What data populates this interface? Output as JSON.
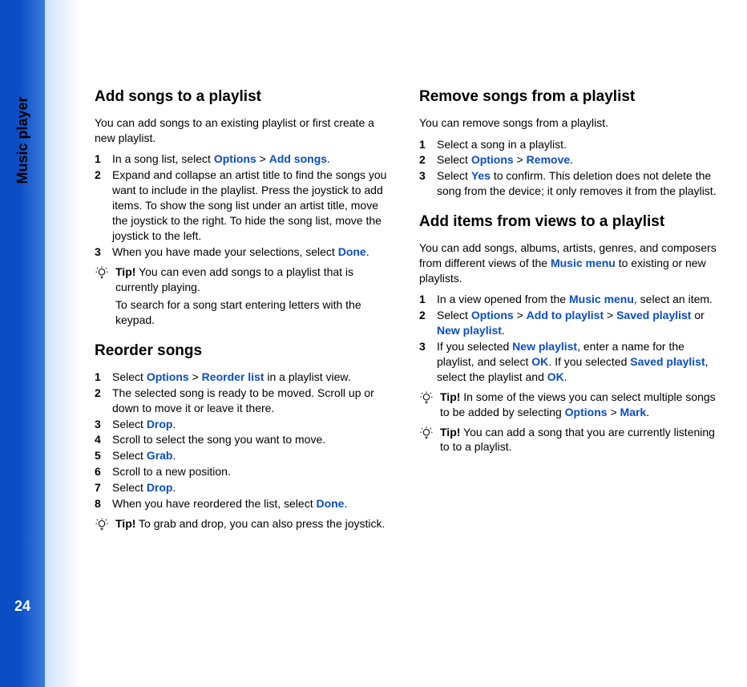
{
  "page": {
    "chapter": "Music player",
    "number": "24"
  },
  "left": {
    "s1": {
      "heading": "Add songs to a playlist",
      "intro": "You can add songs to an existing playlist or first create a new playlist.",
      "step1_a": "In a song list, select ",
      "step1_options": "Options",
      "step1_gt": " > ",
      "step1_add": "Add songs",
      "step1_end": ".",
      "step2": "Expand and collapse an artist title to find the songs you want to include in the playlist.  Press the joystick to add items.  To show the song list under an artist title, move the joystick to the right.  To hide the song list, move the joystick to the left.",
      "step3_a": "When you have made your selections, select ",
      "step3_done": "Done",
      "step3_end": ".",
      "tip_label": "Tip!",
      "tip_body": " You can even add songs to a playlist that is currently playing.",
      "tip_extra": "To search for a song start entering letters with the keypad."
    },
    "s2": {
      "heading": "Reorder songs",
      "step1_a": "Select ",
      "step1_options": "Options",
      "step1_gt": " > ",
      "step1_reorder": "Reorder list",
      "step1_end": " in a playlist view.",
      "step2": "The selected song is ready to be moved. Scroll up or down to move it or leave it there.",
      "step3_a": "Select ",
      "step3_drop": "Drop",
      "step3_end": ".",
      "step4": "Scroll to select the song you want to move.",
      "step5_a": "Select ",
      "step5_grab": "Grab",
      "step5_end": ".",
      "step6": "Scroll to a new position.",
      "step7_a": "Select ",
      "step7_drop": "Drop",
      "step7_end": ".",
      "step8_a": "When you have reordered the list, select ",
      "step8_done": "Done",
      "step8_end": ".",
      "tip_label": "Tip!",
      "tip_body": " To grab and drop, you can also press the joystick."
    }
  },
  "right": {
    "s1": {
      "heading": "Remove songs from a playlist",
      "intro": "You can remove songs from a playlist.",
      "step1": "Select a song in a playlist.",
      "step2_a": "Select ",
      "step2_options": "Options",
      "step2_gt": " > ",
      "step2_remove": "Remove",
      "step2_end": ".",
      "step3_a": "Select ",
      "step3_yes": "Yes",
      "step3_end": " to confirm. This deletion does not delete the song from the device; it only removes it from the playlist."
    },
    "s2": {
      "heading": "Add items from views to a playlist",
      "intro_a": "You can add songs, albums, artists, genres, and composers from different views of the ",
      "intro_menu": "Music menu",
      "intro_b": " to existing or new playlists.",
      "step1_a": "In a view opened from the ",
      "step1_menu": "Music menu",
      "step1_b": ", select an item.",
      "step2_a": "Select ",
      "step2_options": "Options",
      "step2_gt1": " > ",
      "step2_addto": "Add to playlist",
      "step2_gt2": " > ",
      "step2_saved": "Saved playlist",
      "step2_or": " or ",
      "step2_new": "New playlist",
      "step2_end": ".",
      "step3_a": "If you selected ",
      "step3_new": "New playlist",
      "step3_b": ", enter a name for the playlist, and select ",
      "step3_ok1": "OK",
      "step3_c": ". If you selected ",
      "step3_saved": "Saved playlist",
      "step3_d": ", select the playlist and ",
      "step3_ok2": "OK",
      "step3_end": ".",
      "tip1_label": "Tip!",
      "tip1_a": " In some of the views you can select multiple songs to be added by selecting ",
      "tip1_options": "Options",
      "tip1_gt": " > ",
      "tip1_mark": "Mark",
      "tip1_end": ".",
      "tip2_label": "Tip!",
      "tip2_body": " You can add a song that you are currently listening to to a playlist."
    }
  },
  "nums": {
    "n1": "1",
    "n2": "2",
    "n3": "3",
    "n4": "4",
    "n5": "5",
    "n6": "6",
    "n7": "7",
    "n8": "8"
  }
}
